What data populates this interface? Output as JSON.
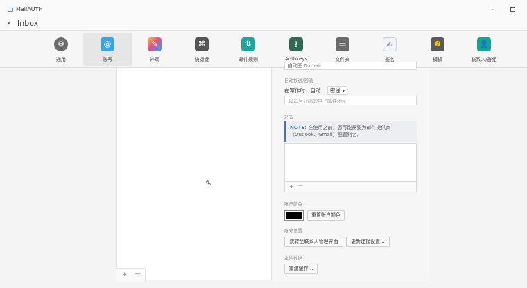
{
  "app": {
    "title": "MailAUTH",
    "back_arrow": "‹",
    "back_label": "Inbox",
    "minimize": "–"
  },
  "toolbar": {
    "items": [
      {
        "label": "通用",
        "icon": "gear-icon",
        "glyph": "⚙"
      },
      {
        "label": "账号",
        "icon": "at-sign-icon",
        "glyph": "@"
      },
      {
        "label": "外观",
        "icon": "palette-icon",
        "glyph": "✎"
      },
      {
        "label": "快捷键",
        "icon": "command-key-icon",
        "glyph": "⌘"
      },
      {
        "label": "邮件规则",
        "icon": "rules-arrows-icon",
        "glyph": "⇅"
      },
      {
        "label": "Authkeys",
        "icon": "key-icon",
        "glyph": "⚷"
      },
      {
        "label": "文件夹",
        "icon": "folder-icon",
        "glyph": "▭"
      },
      {
        "label": "签名",
        "icon": "signature-icon",
        "glyph": "✍"
      },
      {
        "label": "模板",
        "icon": "template-icon",
        "glyph": "❼"
      },
      {
        "label": "联系人/群组",
        "icon": "contacts-icon",
        "glyph": "👤"
      }
    ],
    "active_index": 1
  },
  "list_footer": {
    "add": "+",
    "remove": "—"
  },
  "settings": {
    "cut_field_value": "自动图 Oxmail",
    "auto_cc": {
      "section_label": "自动抄送/密送",
      "row_prefix": "在写作时，自动",
      "select_value": "密送 ▾",
      "row_suffix": "：",
      "placeholder": "以逗号分隔的电子邮件地址"
    },
    "alias": {
      "section_label": "别名",
      "note_title": "NOTE:",
      "note_text": "在使用之前，您可能需要为邮件提供商（Outlook、Gmail）配置别名。",
      "add": "+",
      "remove": "—"
    },
    "account_color": {
      "section_label": "账户颜色",
      "swatch_color": "#000000",
      "reset_button": "重置账户颜色"
    },
    "account_settings": {
      "section_label": "账号设置",
      "contacts_button": "跳转至联系人管理界面",
      "update_button": "更新连接设置..."
    },
    "local_data": {
      "section_label": "本地数据",
      "rebuild_button": "重建缓存..."
    }
  }
}
